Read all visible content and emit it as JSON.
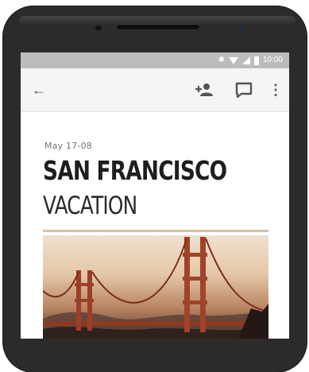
{
  "status_bar": {
    "time": "10:00",
    "icons": [
      "bluetooth-icon",
      "wifi-icon",
      "signal-icon",
      "battery-icon"
    ]
  },
  "toolbar": {
    "back_icon": "back-arrow-icon",
    "actions": [
      "add-person-icon",
      "comment-icon",
      "more-vert-icon"
    ]
  },
  "article": {
    "date": "May 17-08",
    "title_line1": "SAN FRANCISCO",
    "title_line2": "VACATION",
    "accent_color": "#d8c2a0"
  },
  "photo": {
    "subject": "golden-gate-bridge-image"
  }
}
